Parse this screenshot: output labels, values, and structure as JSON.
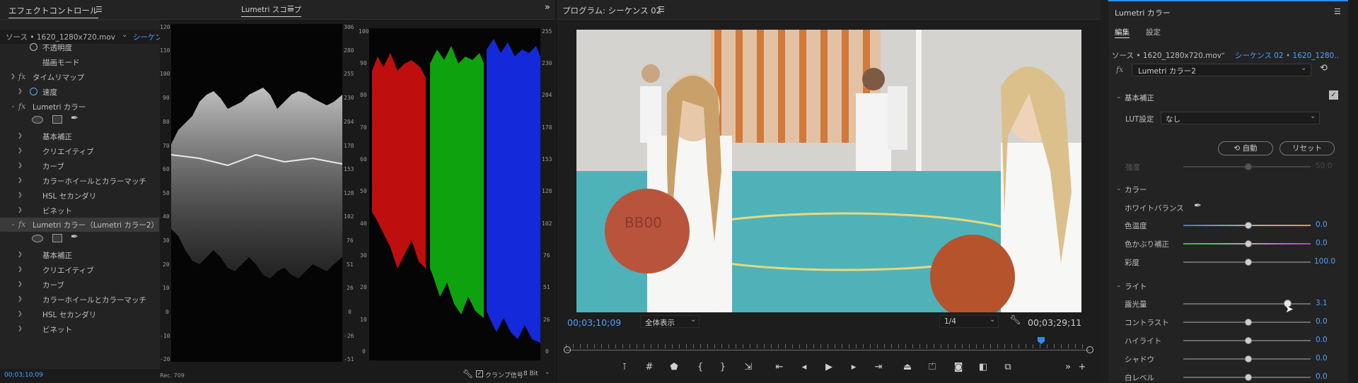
{
  "effect_controls": {
    "title": "エフェクトコントロール",
    "source": "ソース • 1620_1280x720.mov",
    "sequence": "シーケンス",
    "rows": [
      "不透明度",
      "描画モード",
      "タイムリマップ",
      "速度",
      "Lumetri カラー",
      "基本補正",
      "クリエイティブ",
      "カーブ",
      "カラーホイールとカラーマッチ",
      "HSL セカンダリ",
      "ビネット",
      "Lumetri カラー（Lumetri カラー2）",
      "基本補正",
      "クリエイティブ",
      "カーブ",
      "カラーホイールとカラーマッチ",
      "HSL セカンダリ",
      "ビネット"
    ],
    "timecode": "00;03;10;09"
  },
  "scope": {
    "title": "Lumetri スコープ",
    "left_axis": [
      "120",
      "110",
      "100",
      "90",
      "80",
      "70",
      "60",
      "50",
      "40",
      "30",
      "20",
      "10",
      "0",
      "-10",
      "-20"
    ],
    "right_axis": [
      "306",
      "280",
      "255",
      "230",
      "204",
      "178",
      "153",
      "128",
      "102",
      "76",
      "51",
      "26",
      "0",
      "-26",
      "-51"
    ],
    "parade_left_axis": [
      "100",
      "90",
      "80",
      "70",
      "60",
      "50",
      "40",
      "30",
      "20",
      "10",
      "0"
    ],
    "parade_right_axis": [
      "255",
      "230",
      "204",
      "178",
      "153",
      "128",
      "102",
      "76",
      "51",
      "26",
      "0"
    ],
    "standard": "Rec. 709",
    "clamp": "クランプ信号",
    "bits": "8 Bit"
  },
  "program": {
    "title": "プログラム: シーケンス 02",
    "timecode": "00;03;10;09",
    "fit": "全体表示",
    "resolution": "1/4",
    "duration": "00;03;29;11",
    "ball_text": "BB00"
  },
  "lumetri": {
    "title": "Lumetri カラー",
    "tabs": [
      "編集",
      "設定"
    ],
    "source": "ソース • 1620_1280x720.mov",
    "sequence": "シーケンス 02 • 1620_1280...",
    "effect": "Lumetri カラー2",
    "basic": "基本補正",
    "lut_label": "LUT設定",
    "lut_value": "なし",
    "auto": "自動",
    "reset": "リセット",
    "intensity": "強度",
    "intensity_val": "50.0",
    "color_section": "カラー",
    "wb": "ホワイトバランス",
    "temp": "色温度",
    "temp_val": "0.0",
    "tint": "色かぶり補正",
    "tint_val": "0.0",
    "sat": "彩度",
    "sat_val": "100.0",
    "light_section": "ライト",
    "exposure": "露光量",
    "exposure_val": "3.1",
    "contrast": "コントラスト",
    "contrast_val": "0.0",
    "highlight": "ハイライト",
    "highlight_val": "0.0",
    "shadow": "シャドウ",
    "shadow_val": "0.0",
    "white": "白レベル",
    "white_val": "0.0"
  }
}
